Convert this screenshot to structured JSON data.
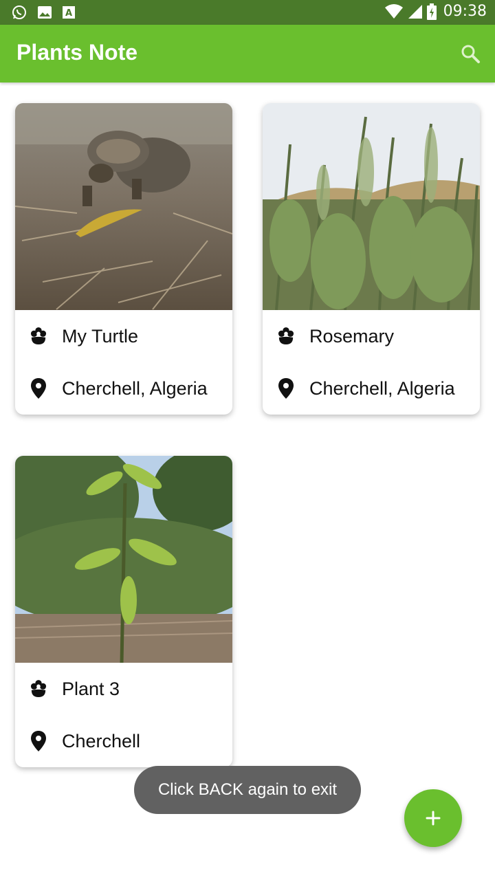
{
  "status_bar": {
    "time": "09:38",
    "left_icons": [
      "whatsapp-icon",
      "image-icon",
      "text-icon"
    ],
    "right_icons": [
      "wifi-icon",
      "signal-icon",
      "battery-icon"
    ]
  },
  "app_bar": {
    "title": "Plants Note",
    "search_icon": "search-icon"
  },
  "notes": [
    {
      "name": "My Turtle",
      "location": "Cherchell, Algeria"
    },
    {
      "name": "Rosemary",
      "location": "Cherchell, Algeria"
    },
    {
      "name": "Plant 3",
      "location": "Cherchell"
    }
  ],
  "toast": {
    "text": "Click BACK again to exit"
  },
  "fab": {
    "icon": "plus-icon"
  },
  "colors": {
    "primary": "#6abf2e",
    "status_bar": "#4a7a2a",
    "toast_bg": "#616161"
  }
}
